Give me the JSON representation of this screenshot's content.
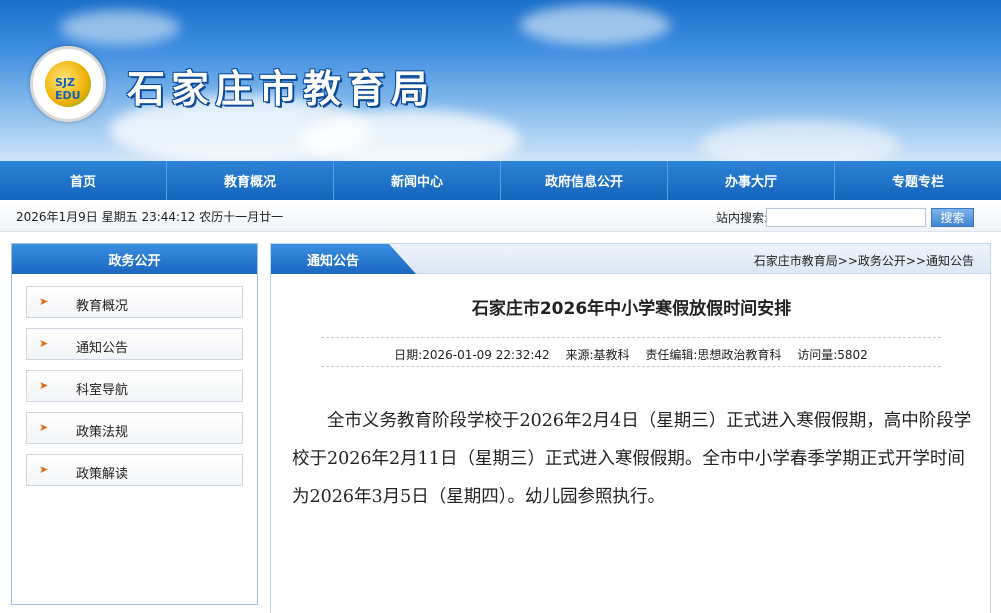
{
  "header": {
    "site_title": "石家庄市教育局",
    "logo_text": "SJZ EDU"
  },
  "nav": {
    "items": [
      "首页",
      "教育概况",
      "新闻中心",
      "政府信息公开",
      "办事大厅",
      "专题专栏"
    ]
  },
  "infobar": {
    "datetime": "2026年1月9日 星期五 23:44:12 农历十一月廿一",
    "search_label": "站内搜索:",
    "search_value": "",
    "search_button": "搜索"
  },
  "sidebar": {
    "title": "政务公开",
    "items": [
      {
        "label": "教育概况"
      },
      {
        "label": "通知公告"
      },
      {
        "label": "科室导航"
      },
      {
        "label": "政策法规"
      },
      {
        "label": "政策解读"
      }
    ],
    "arrow_icon": "arrow-right-icon"
  },
  "main": {
    "tab_label": "通知公告",
    "breadcrumb": "石家庄市教育局>>政务公开>>通知公告",
    "article": {
      "title": "石家庄市2026年中小学寒假放假时间安排",
      "meta": {
        "date": "日期:2026-01-09 22:32:42",
        "source": "来源:基教科",
        "editor": "责任编辑:思想政治教育科",
        "visits": "访问量:5802"
      },
      "body": "全市义务教育阶段学校于2026年2月4日（星期三）正式进入寒假假期，高中阶段学校于2026年2月11日（星期三）正式进入寒假假期。全市中小学春季学期正式开学时间为2026年3月5日（星期四）。幼儿园参照执行。"
    }
  },
  "colors": {
    "nav_blue": "#1464bc",
    "arrow_orange": "#e06a10",
    "banner_sky": "#3d8de0"
  }
}
